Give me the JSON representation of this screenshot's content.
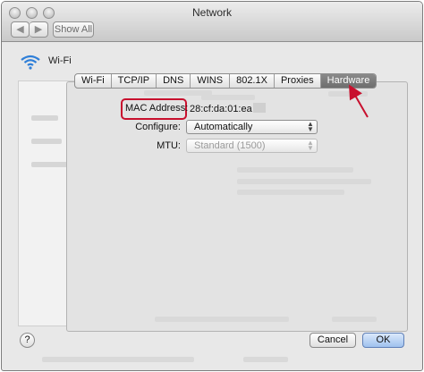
{
  "window": {
    "title": "Network"
  },
  "toolbar": {
    "show_all_label": "Show All",
    "back_icon": "back-arrow-icon",
    "forward_icon": "grid-icon"
  },
  "service": {
    "name": "Wi-Fi",
    "icon": "wifi-icon"
  },
  "tabs": [
    {
      "label": "Wi-Fi",
      "active": false
    },
    {
      "label": "TCP/IP",
      "active": false
    },
    {
      "label": "DNS",
      "active": false
    },
    {
      "label": "WINS",
      "active": false
    },
    {
      "label": "802.1X",
      "active": false
    },
    {
      "label": "Proxies",
      "active": false
    },
    {
      "label": "Hardware",
      "active": true
    }
  ],
  "hardware": {
    "mac_label": "MAC Address:",
    "mac_value": "28:cf:da:01:ea",
    "configure_label": "Configure:",
    "configure_value": "Automatically",
    "mtu_label": "MTU:",
    "mtu_value": "Standard  (1500)"
  },
  "footer": {
    "help_label": "?",
    "cancel_label": "Cancel",
    "ok_label": "OK"
  },
  "colors": {
    "highlight": "#c8102e",
    "arrow": "#c8102e",
    "active_tab": "#767676",
    "wifi": "#2f7fd8"
  }
}
